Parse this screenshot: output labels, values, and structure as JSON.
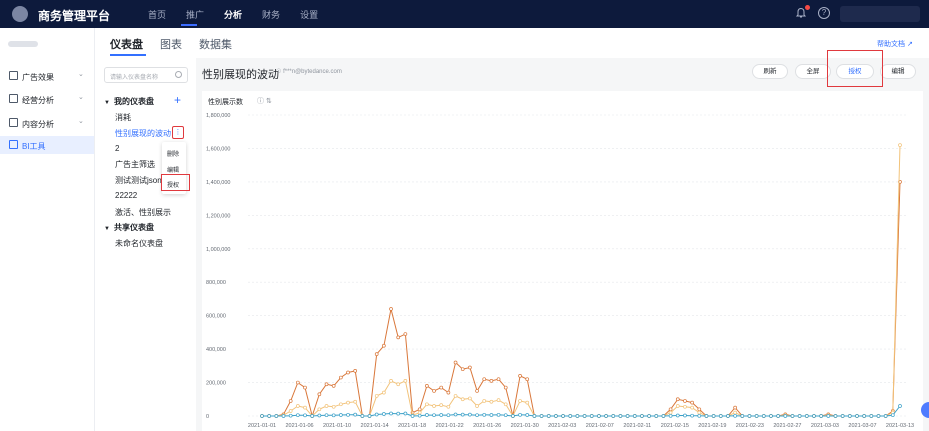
{
  "topbar": {
    "brand": "商务管理平台",
    "nav": [
      "首页",
      "推广",
      "分析",
      "财务",
      "设置"
    ],
    "active_nav": "分析",
    "bell_icon": "bell-icon",
    "help_icon": "help-icon",
    "help_glyph": "?"
  },
  "sidebar": {
    "items": [
      {
        "label": "广告效果",
        "icon": "ad-effect-icon",
        "expandable": true
      },
      {
        "label": "经营分析",
        "icon": "business-analysis-icon",
        "expandable": true
      },
      {
        "label": "内容分析",
        "icon": "content-analysis-icon",
        "expandable": true
      },
      {
        "label": "BI工具",
        "icon": "bi-tool-icon",
        "expandable": false,
        "active": true
      }
    ]
  },
  "tabs": [
    "仪表盘",
    "图表",
    "数据集"
  ],
  "help_doc": "帮助文档",
  "dash_list": {
    "search_placeholder": "请输入仪表盘名称",
    "group_mine": "我的仪表盘",
    "my_items": [
      "消耗",
      "性别展现的波动",
      "2",
      "广告主筛选",
      "测试测试json",
      "22222",
      "激活、性别展示"
    ],
    "selected": "性别展现的波动",
    "group_shared": "共享仪表盘",
    "shared_items": [
      "未命名仪表盘"
    ],
    "context_menu": [
      "删除",
      "编辑",
      "授权"
    ],
    "kebab_glyph": "⋮",
    "plus_glyph": "+"
  },
  "dashboard": {
    "title": "性别展现的波动",
    "owner": "f***n@bytedance.com",
    "buttons": {
      "refresh": "刷新",
      "fullscreen": "全屏",
      "authorize": "授权",
      "edit": "编辑"
    }
  },
  "colors": {
    "accent": "#3370ff",
    "highlight_box": "#e0393e",
    "series_orange": "#d9773a",
    "series_light": "#f2c37a",
    "series_teal": "#3aa0c8"
  },
  "chart_data": {
    "type": "line",
    "title": "性别展示数",
    "ylim": [
      0,
      1800000
    ],
    "yticks": [
      0,
      200000,
      400000,
      600000,
      800000,
      1000000,
      1200000,
      1400000,
      1600000,
      1800000
    ],
    "ytick_labels": [
      "0",
      "200,000",
      "400,000",
      "600,000",
      "800,000",
      "1,000,000",
      "1,200,000",
      "1,400,000",
      "1,600,000",
      "1,800,000"
    ],
    "xtick_labels": [
      "2021-01-01",
      "2021-01-06",
      "2021-01-10",
      "2021-01-14",
      "2021-01-18",
      "2021-01-22",
      "2021-01-26",
      "2021-01-30",
      "2021-02-03",
      "2021-02-07",
      "2021-02-11",
      "2021-02-15",
      "2021-02-19",
      "2021-02-23",
      "2021-02-27",
      "2021-03-03",
      "2021-03-07",
      "2021-03-13"
    ],
    "grid": true,
    "series": [
      {
        "values": [
          0,
          0,
          0,
          10000,
          90000,
          200000,
          170000,
          0,
          130000,
          190000,
          180000,
          230000,
          260000,
          270000,
          0,
          0,
          370000,
          420000,
          640000,
          470000,
          490000,
          20000,
          40000,
          180000,
          150000,
          170000,
          140000,
          320000,
          280000,
          290000,
          150000,
          220000,
          210000,
          220000,
          170000,
          0,
          240000,
          220000,
          0,
          0,
          0,
          0,
          0,
          0,
          0,
          0,
          0,
          0,
          0,
          0,
          0,
          0,
          0,
          0,
          0,
          0,
          0,
          40000,
          100000,
          90000,
          80000,
          40000,
          0,
          0,
          0,
          0,
          50000,
          0,
          0,
          0,
          0,
          0,
          0,
          10000,
          0,
          0,
          0,
          0,
          0,
          10000,
          0,
          0,
          0,
          0,
          0,
          0,
          0,
          0,
          30000,
          1400000
        ]
      },
      {
        "values": [
          0,
          0,
          0,
          5000,
          30000,
          60000,
          50000,
          0,
          40000,
          60000,
          55000,
          70000,
          80000,
          85000,
          0,
          0,
          120000,
          140000,
          210000,
          190000,
          210000,
          5000,
          20000,
          70000,
          60000,
          65000,
          55000,
          120000,
          100000,
          105000,
          60000,
          90000,
          85000,
          95000,
          70000,
          0,
          90000,
          80000,
          0,
          0,
          0,
          0,
          0,
          0,
          0,
          0,
          0,
          0,
          0,
          0,
          0,
          0,
          0,
          0,
          0,
          0,
          0,
          20000,
          60000,
          55000,
          50000,
          20000,
          0,
          0,
          0,
          0,
          20000,
          0,
          0,
          0,
          0,
          0,
          0,
          5000,
          0,
          0,
          0,
          0,
          0,
          5000,
          0,
          0,
          0,
          0,
          0,
          0,
          0,
          0,
          20000,
          1620000
        ]
      },
      {
        "values": [
          0,
          0,
          0,
          0,
          2000,
          5000,
          4000,
          0,
          3000,
          5000,
          4000,
          6000,
          7000,
          8000,
          0,
          0,
          9000,
          12000,
          15000,
          14000,
          15000,
          0,
          2000,
          6000,
          5000,
          6000,
          5000,
          9000,
          8000,
          8000,
          5000,
          7000,
          6000,
          7000,
          5000,
          0,
          7000,
          6000,
          0,
          0,
          0,
          0,
          0,
          0,
          0,
          0,
          0,
          0,
          0,
          0,
          0,
          0,
          0,
          0,
          0,
          0,
          0,
          1000,
          3000,
          3000,
          2000,
          1000,
          0,
          0,
          0,
          0,
          1000,
          0,
          0,
          0,
          0,
          0,
          0,
          0,
          0,
          0,
          0,
          0,
          0,
          0,
          0,
          0,
          0,
          0,
          0,
          0,
          0,
          0,
          5000,
          60000
        ]
      }
    ]
  }
}
